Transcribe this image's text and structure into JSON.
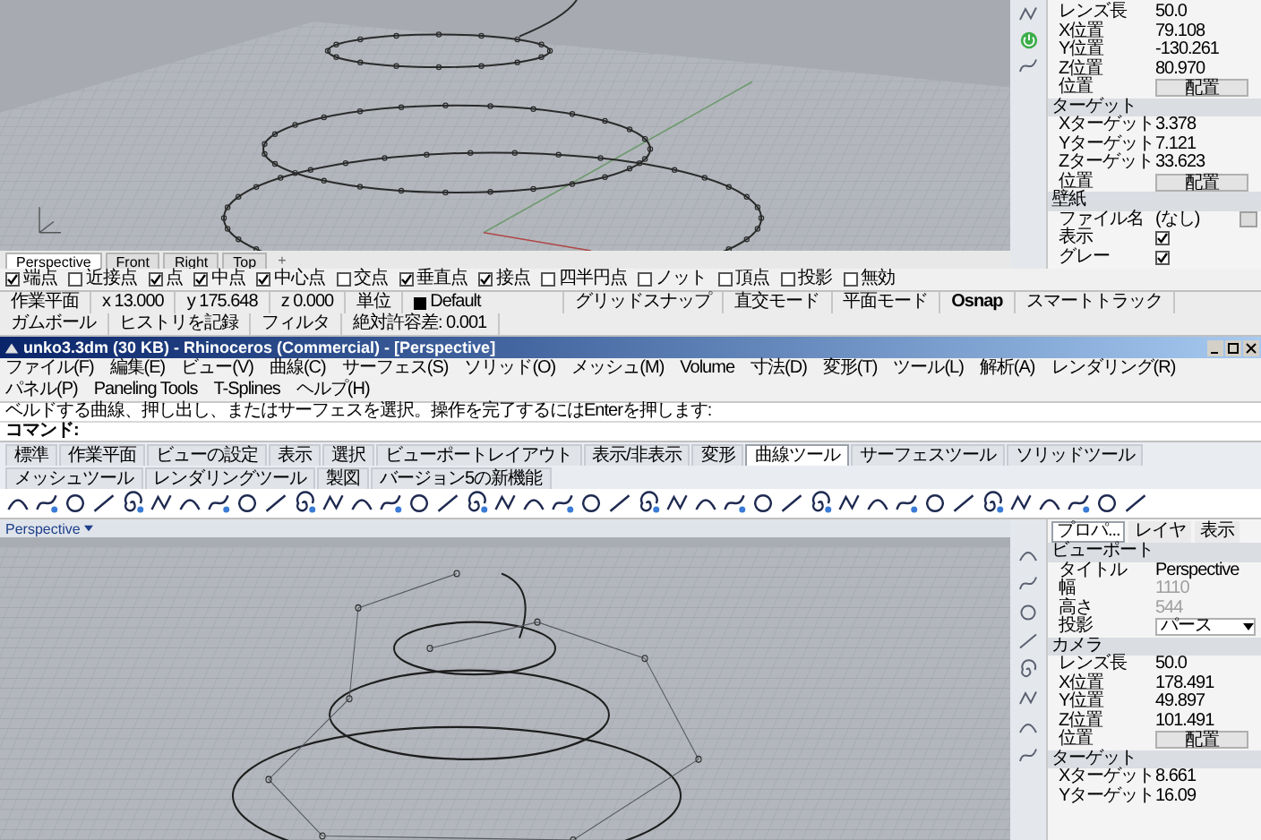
{
  "top_viewport": {
    "tabs": [
      {
        "label": "Perspective",
        "selected": true
      },
      {
        "label": "Front",
        "selected": false
      },
      {
        "label": "Right",
        "selected": false
      },
      {
        "label": "Top",
        "selected": false
      }
    ],
    "add_tab": "+"
  },
  "top_panel": {
    "rows": [
      {
        "kind": "field",
        "label": "レンズ長",
        "value": "50.0"
      },
      {
        "kind": "field",
        "label": "X位置",
        "value": "79.108"
      },
      {
        "kind": "field",
        "label": "Y位置",
        "value": "-130.261"
      },
      {
        "kind": "field",
        "label": "Z位置",
        "value": "80.970"
      },
      {
        "kind": "button",
        "label": "位置",
        "value": "配置"
      },
      {
        "kind": "header",
        "label": "ターゲット"
      },
      {
        "kind": "field",
        "label": "Xターゲット",
        "value": "3.378"
      },
      {
        "kind": "field",
        "label": "Yターゲット",
        "value": "7.121"
      },
      {
        "kind": "field",
        "label": "Zターゲット",
        "value": "33.623"
      },
      {
        "kind": "button",
        "label": "位置",
        "value": "配置"
      },
      {
        "kind": "header",
        "label": "壁紙"
      },
      {
        "kind": "file",
        "label": "ファイル名",
        "value": "(なし)"
      },
      {
        "kind": "check",
        "label": "表示",
        "checked": true
      },
      {
        "kind": "check",
        "label": "グレー",
        "checked": true
      }
    ]
  },
  "osnaps": [
    {
      "label": "端点",
      "checked": true
    },
    {
      "label": "近接点",
      "checked": false
    },
    {
      "label": "点",
      "checked": true
    },
    {
      "label": "中点",
      "checked": true
    },
    {
      "label": "中心点",
      "checked": true
    },
    {
      "label": "交点",
      "checked": false
    },
    {
      "label": "垂直点",
      "checked": true
    },
    {
      "label": "接点",
      "checked": true
    },
    {
      "label": "四半円点",
      "checked": false
    },
    {
      "label": "ノット",
      "checked": false
    },
    {
      "label": "頂点",
      "checked": false
    },
    {
      "label": "投影",
      "checked": false
    },
    {
      "label": "無効",
      "checked": false
    }
  ],
  "status_bar": [
    {
      "kind": "text",
      "text": "作業平面"
    },
    {
      "kind": "text",
      "text": "x 13.000"
    },
    {
      "kind": "text",
      "text": "y 175.648"
    },
    {
      "kind": "text",
      "text": "z 0.000"
    },
    {
      "kind": "text",
      "text": "単位"
    },
    {
      "kind": "layer",
      "text": "Default"
    },
    {
      "kind": "toggle",
      "text": "グリッドスナップ",
      "on": false
    },
    {
      "kind": "toggle",
      "text": "直交モード",
      "on": false
    },
    {
      "kind": "toggle",
      "text": "平面モード",
      "on": false
    },
    {
      "kind": "toggle",
      "text": "Osnap",
      "on": true
    },
    {
      "kind": "toggle",
      "text": "スマートトラック",
      "on": false
    },
    {
      "kind": "toggle",
      "text": "ガムボール",
      "on": false
    },
    {
      "kind": "toggle",
      "text": "ヒストリを記録",
      "on": false
    },
    {
      "kind": "toggle",
      "text": "フィルタ",
      "on": false
    },
    {
      "kind": "text",
      "text": "絶対許容差: 0.001"
    }
  ],
  "window": {
    "title": "unko3.3dm (30 KB) - Rhinoceros (Commercial) - [Perspective]"
  },
  "menu": [
    "ファイル(F)",
    "編集(E)",
    "ビュー(V)",
    "曲線(C)",
    "サーフェス(S)",
    "ソリッド(O)",
    "メッシュ(M)",
    "Volume",
    "寸法(D)",
    "変形(T)",
    "ツール(L)",
    "解析(A)",
    "レンダリング(R)",
    "パネル(P)",
    "Paneling Tools",
    "T-Splines",
    "ヘルプ(H)"
  ],
  "command": {
    "history": "ベルドする曲線、押し出し、またはサーフェスを選択。操作を完了するにはEnterを押します:",
    "prompt": "コマンド:"
  },
  "toolbar_tabs": [
    {
      "label": "標準",
      "selected": false
    },
    {
      "label": "作業平面",
      "selected": false
    },
    {
      "label": "ビューの設定",
      "selected": false
    },
    {
      "label": "表示",
      "selected": false
    },
    {
      "label": "選択",
      "selected": false
    },
    {
      "label": "ビューポートレイアウト",
      "selected": false
    },
    {
      "label": "表示/非表示",
      "selected": false
    },
    {
      "label": "変形",
      "selected": false
    },
    {
      "label": "曲線ツール",
      "selected": true
    },
    {
      "label": "サーフェスツール",
      "selected": false
    },
    {
      "label": "ソリッドツール",
      "selected": false
    },
    {
      "label": "メッシュツール",
      "selected": false
    },
    {
      "label": "レンダリングツール",
      "selected": false
    },
    {
      "label": "製図",
      "selected": false
    },
    {
      "label": "バージョン5の新機能",
      "selected": false
    }
  ],
  "bottom_viewport": {
    "title": "Perspective"
  },
  "bottom_panel": {
    "tabs": [
      {
        "label": "プロパ...",
        "selected": true
      },
      {
        "label": "レイヤ",
        "selected": false
      },
      {
        "label": "表示",
        "selected": false
      }
    ],
    "rows": [
      {
        "kind": "header",
        "label": "ビューポート"
      },
      {
        "kind": "field",
        "label": "タイトル",
        "value": "Perspective",
        "disabled": false
      },
      {
        "kind": "field",
        "label": "幅",
        "value": "1110",
        "disabled": true
      },
      {
        "kind": "field",
        "label": "高さ",
        "value": "544",
        "disabled": true
      },
      {
        "kind": "dropdown",
        "label": "投影",
        "value": "パース"
      },
      {
        "kind": "header",
        "label": "カメラ"
      },
      {
        "kind": "field",
        "label": "レンズ長",
        "value": "50.0",
        "disabled": false
      },
      {
        "kind": "field",
        "label": "X位置",
        "value": "178.491",
        "disabled": false
      },
      {
        "kind": "field",
        "label": "Y位置",
        "value": "49.897",
        "disabled": false
      },
      {
        "kind": "field",
        "label": "Z位置",
        "value": "101.491",
        "disabled": false
      },
      {
        "kind": "button",
        "label": "位置",
        "value": "配置"
      },
      {
        "kind": "header",
        "label": "ターゲット"
      },
      {
        "kind": "field",
        "label": "Xターゲット",
        "value": "8.661",
        "disabled": false
      },
      {
        "kind": "field",
        "label": "Yターゲット",
        "value": "16.09",
        "disabled": false
      }
    ]
  }
}
